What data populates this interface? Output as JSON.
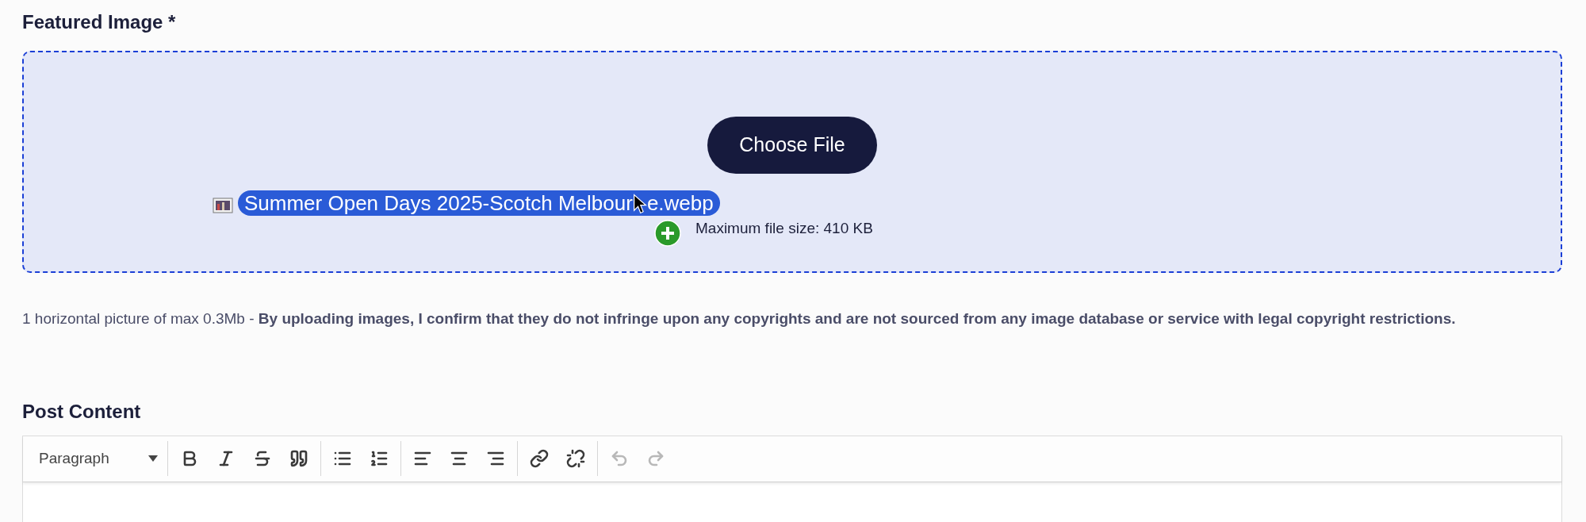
{
  "featured_image": {
    "label": "Featured Image *",
    "dropzone": {
      "button": "Choose File",
      "dragged_file": [
        "Summer Open Days 2025-Scotch Melbour",
        "e.webp"
      ],
      "max_size": "Maximum file size: 410 KB"
    },
    "help_text": "1 horizontal picture of max 0.3Mb - **By uploading images, I confirm that they do not infringe upon any copyrights and are not sourced from any image database or service with legal copyright restrictions.**"
  },
  "post_content": {
    "label": "Post Content",
    "toolbar": {
      "format_select": "Paragraph",
      "groups": [
        [
          {
            "kind": "bold",
            "disabled": false
          },
          {
            "kind": "italic",
            "disabled": false
          },
          {
            "kind": "strikethrough",
            "disabled": false
          },
          {
            "kind": "quote",
            "disabled": false
          }
        ],
        [
          {
            "kind": "bullet-list",
            "disabled": false
          },
          {
            "kind": "numbered-list",
            "disabled": false
          }
        ],
        [
          {
            "kind": "align-left",
            "disabled": false
          },
          {
            "kind": "align-center",
            "disabled": false
          },
          {
            "kind": "align-right",
            "disabled": false
          }
        ],
        [
          {
            "kind": "link",
            "disabled": false
          },
          {
            "kind": "unlink",
            "disabled": false
          }
        ],
        [
          {
            "kind": "undo",
            "disabled": true
          },
          {
            "kind": "redo",
            "disabled": true
          }
        ]
      ]
    }
  }
}
